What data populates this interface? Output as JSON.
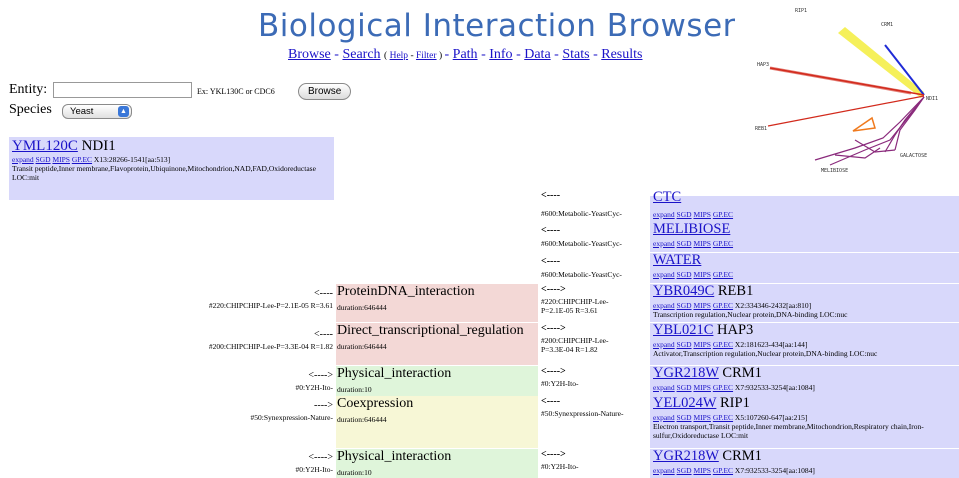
{
  "header": {
    "title": "Biological Interaction Browser",
    "nav": {
      "browse": "Browse",
      "search": "Search",
      "help": "Help",
      "filter": "Filter",
      "path": "Path",
      "info": "Info",
      "data": "Data",
      "stats": "Stats",
      "results": "Results"
    }
  },
  "graph": {
    "nodes": [
      "RIP1",
      "CRM1",
      "HAP3",
      "NDI1",
      "REB1",
      "GALACTOSE",
      "MELIBIOSE"
    ],
    "colors": {
      "yellow": "#f5f05a",
      "blue": "#1f2bd6",
      "red": "#d22a1c",
      "orange": "#f07a1e",
      "purple": "#8a2a7c"
    }
  },
  "form": {
    "entity_label": "Entity:",
    "entity_value": "",
    "entity_hint": "Ex: YKL130C or CDC6",
    "browse_button": "Browse",
    "species_label": "Species",
    "species_value": "Yeast"
  },
  "entity": {
    "id": "YML120C",
    "name": "NDI1",
    "link_expand": "expand",
    "link_sgd": "SGD",
    "link_mips": "MIPS",
    "link_gpec": "GP.EC",
    "location": "X13:28266-1541[aa:513]",
    "description": "Transit peptide,Inner membrane,Flavoprotein,Ubiquinone,Mitochondrion,NAD,FAD,Oxidoreductase LOC:mit"
  },
  "rows": [
    {
      "src_arrow": "<----",
      "src_id": "#600:Metabolic-YeastCyc-",
      "tgt_sym": "CTC",
      "links": [
        "expand",
        "SGD",
        "MIPS",
        "GP.EC"
      ]
    },
    {
      "src_arrow": "<----",
      "src_id": "#600:Metabolic-YeastCyc-",
      "tgt_sym": "MELIBIOSE",
      "links": [
        "expand",
        "SGD",
        "MIPS",
        "GP.EC"
      ]
    },
    {
      "src_arrow": "<----",
      "src_id": "#600:Metabolic-YeastCyc-",
      "tgt_sym": "WATER",
      "links": [
        "expand",
        "SGD",
        "MIPS",
        "GP.EC"
      ]
    },
    {
      "left_id": "#220:CHIPCHIP-Lee-P=2.1E-05 R=3.61",
      "left_arrow": "<----",
      "type": "ProteinDNA_interaction",
      "duration": "duration:646444",
      "src_arrow": "<---->",
      "src_id": "#220:CHIPCHIP-Lee-\nP=2.1E-05 R=3.61",
      "tgt_id": "YBR049C",
      "tgt_name": "REB1",
      "links": [
        "expand",
        "SGD",
        "MIPS",
        "GP.EC"
      ],
      "loc": "X2:334346-2432[aa:810]",
      "desc": "Transcription regulation,Nuclear protein,DNA-binding LOC:nuc"
    },
    {
      "left_id": "#200:CHIPCHIP-Lee-P=3.3E-04 R=1.82",
      "left_arrow": "<----",
      "type": "Direct_transcriptional_regulation",
      "duration": "duration:646444",
      "src_arrow": "<---->",
      "src_id": "#200:CHIPCHIP-Lee-\nP=3.3E-04 R=1.82",
      "tgt_id": "YBL021C",
      "tgt_name": "HAP3",
      "links": [
        "expand",
        "SGD",
        "MIPS",
        "GP.EC"
      ],
      "loc": "X2:181623-434[aa:144]",
      "desc": "Activator,Transcription regulation,Nuclear protein,DNA-binding LOC:nuc"
    },
    {
      "left_id": "#0:Y2H-Ito-",
      "left_arrow": "<---->",
      "type": "Physical_interaction",
      "duration": "duration:10",
      "src_arrow": "<---->",
      "src_id": "#0:Y2H-Ito-",
      "tgt_id": "YGR218W",
      "tgt_name": "CRM1",
      "links": [
        "expand",
        "SGD",
        "MIPS",
        "GP.EC"
      ],
      "loc": "X7:932533-3254[aa:1084]",
      "desc": ""
    },
    {
      "left_id": "#50:Synexpression-Nature-",
      "left_arrow": "---->",
      "type": "Coexpression",
      "duration": "duration:646444",
      "src_arrow": "<----",
      "src_id": "#50:Synexpression-Nature-",
      "tgt_id": "YEL024W",
      "tgt_name": "RIP1",
      "links": [
        "expand",
        "SGD",
        "MIPS",
        "GP.EC"
      ],
      "loc": "X5:107260-647[aa:215]",
      "desc": "Electron transport,Transit peptide,Inner membrane,Mitochondrion,Respiratory chain,Iron-sulfur,Oxidoreductase LOC:mit"
    },
    {
      "left_id": "#0:Y2H-Ito-",
      "left_arrow": "<---->",
      "type": "Physical_interaction",
      "duration": "duration:10",
      "src_arrow": "<---->",
      "src_id": "#0:Y2H-Ito-",
      "tgt_id": "YGR218W",
      "tgt_name": "CRM1",
      "links": [
        "expand",
        "SGD",
        "MIPS",
        "GP.EC"
      ],
      "loc": "X7:932533-3254[aa:1084]",
      "desc": ""
    }
  ]
}
